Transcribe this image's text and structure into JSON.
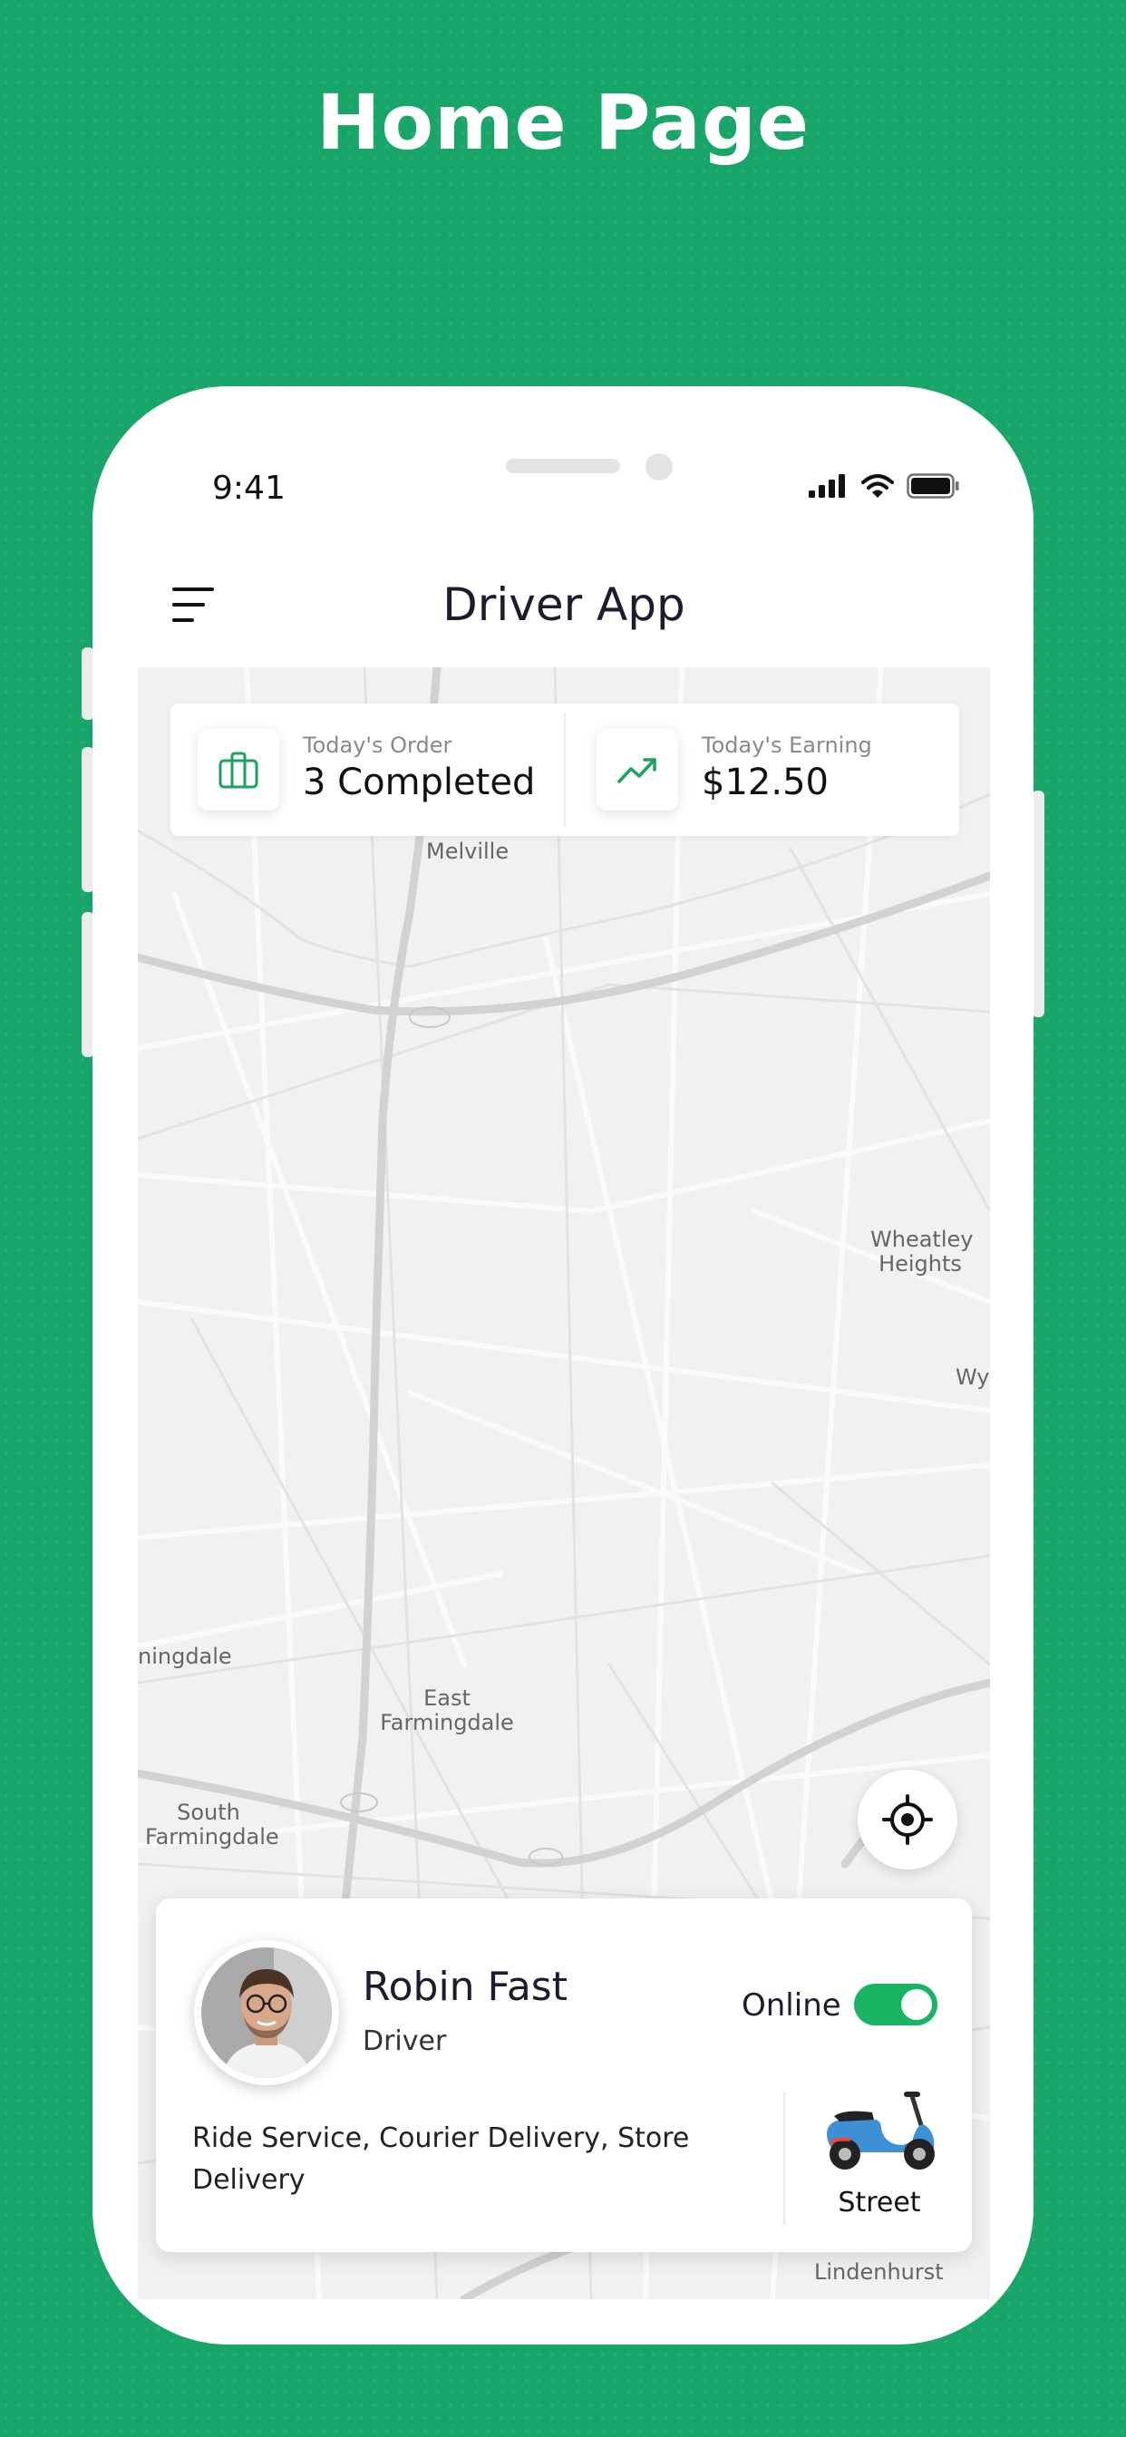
{
  "page": {
    "headline": "Home Page"
  },
  "status_bar": {
    "time": "9:41"
  },
  "header": {
    "title": "Driver App",
    "menu_icon": "hamburger-menu-icon"
  },
  "stats": [
    {
      "icon": "briefcase-icon",
      "label": "Today's Order",
      "value": "3 Completed"
    },
    {
      "icon": "trending-up-icon",
      "label": "Today's Earning",
      "value": "$12.50"
    }
  ],
  "map": {
    "labels": [
      "Melville",
      "Wheatley Heights",
      "Wy",
      "ningdale",
      "East Farmingdale",
      "South Farmingdale",
      "Lindenhurst"
    ]
  },
  "driver": {
    "name": "Robin Fast",
    "role": "Driver",
    "status_label": "Online",
    "online": true,
    "services": "Ride Service, Courier Delivery, Store Delivery",
    "vehicle": "Street"
  },
  "colors": {
    "brand": "#17a568",
    "toggle": "#17b563",
    "icon_accent": "#1aa35e"
  }
}
